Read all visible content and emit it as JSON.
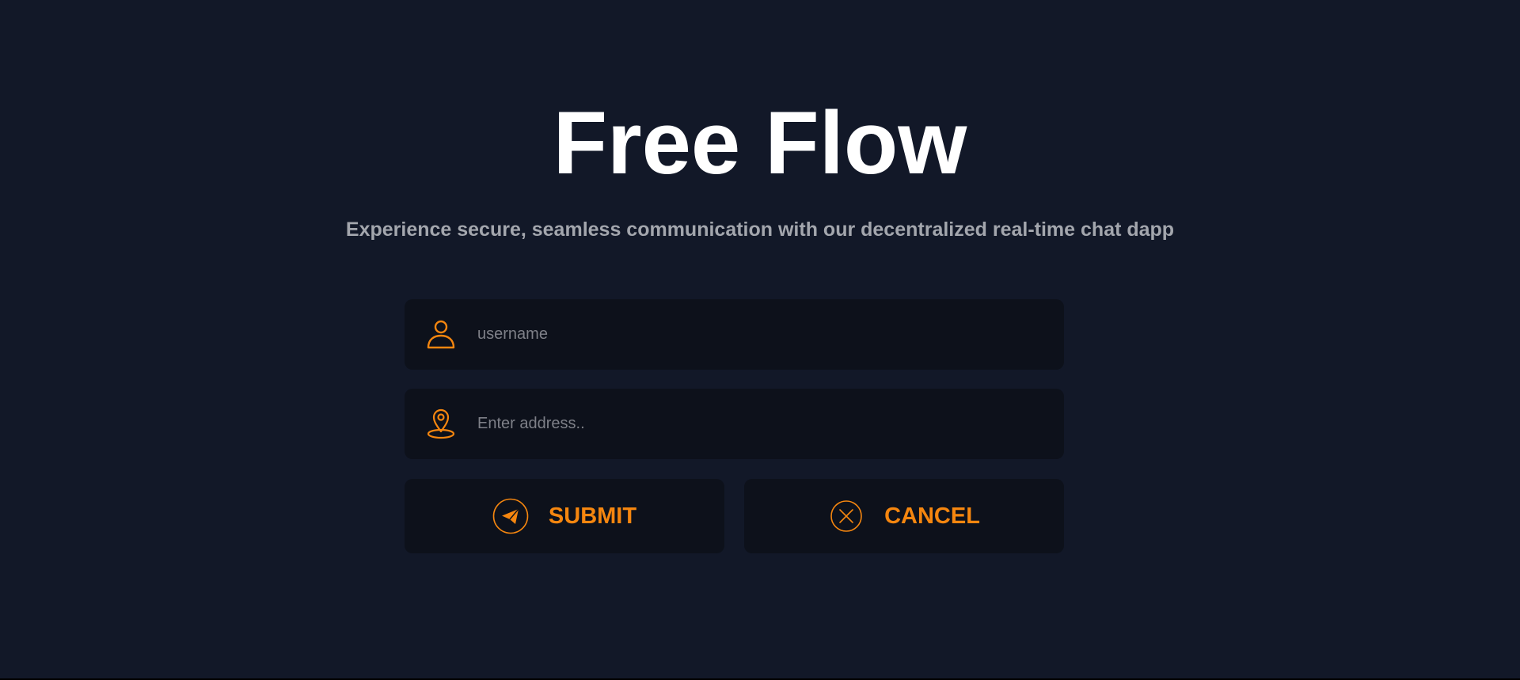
{
  "hero": {
    "title": "Free Flow",
    "subtitle": "Experience secure, seamless communication with our decentralized real-time chat dapp"
  },
  "form": {
    "username": {
      "placeholder": "username",
      "value": "",
      "icon": "user-icon"
    },
    "address": {
      "placeholder": "Enter address..",
      "value": "",
      "icon": "location-pin-icon"
    },
    "submit_label": "SUBMIT",
    "submit_icon": "send-icon",
    "cancel_label": "CANCEL",
    "cancel_icon": "close-circle-icon"
  },
  "colors": {
    "background": "#121828",
    "field_background": "#0d111b",
    "accent": "#f5860f",
    "title": "#ffffff",
    "subtitle": "#a3a6ad",
    "placeholder": "#7e8088"
  }
}
